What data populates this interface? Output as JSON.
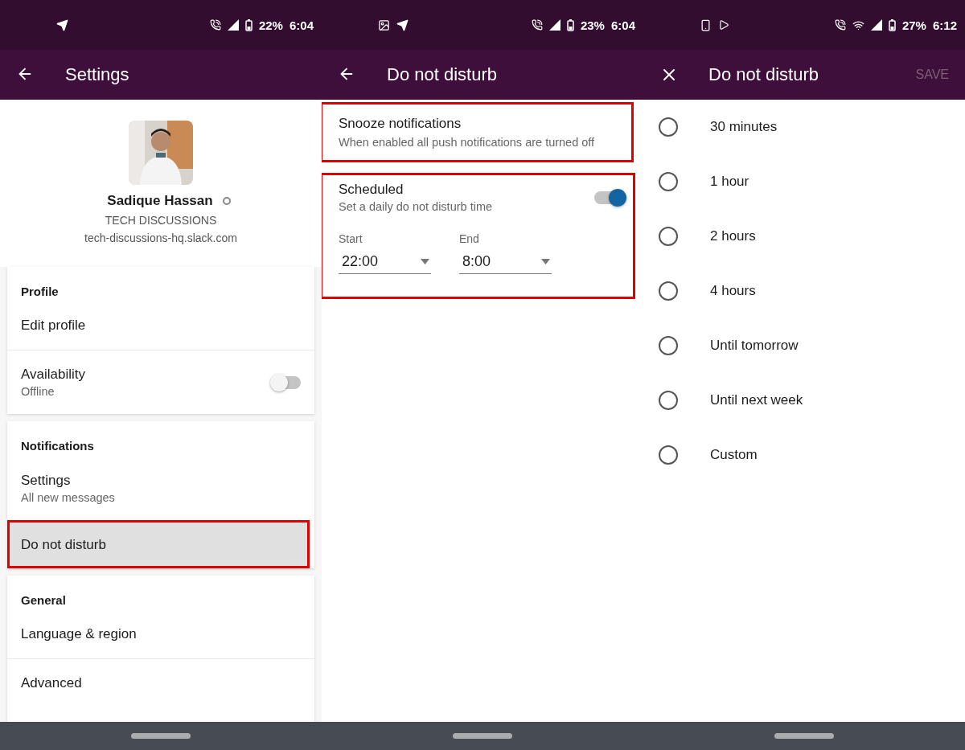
{
  "screens": [
    {
      "kind": "settings",
      "status_bar": {
        "battery": "22%",
        "time": "6:04"
      },
      "app_bar": {
        "nav": {
          "kind": "back"
        },
        "title": "Settings"
      },
      "profile": {
        "name": "Sadique Hassan",
        "online": false,
        "workspace": "TECH DISCUSSIONS",
        "domain": "tech-discussions-hq.slack.com"
      },
      "sections": [
        {
          "header": "Profile",
          "items": [
            {
              "kind": "link",
              "label": "Edit profile"
            },
            {
              "kind": "toggle",
              "label": "Availability",
              "detail": "Offline",
              "on": false
            }
          ]
        },
        {
          "header": "Notifications",
          "items": [
            {
              "kind": "link",
              "label": "Settings",
              "detail": "All new messages"
            },
            {
              "kind": "link",
              "label": "Do not disturb",
              "highlighted": true
            }
          ]
        },
        {
          "header": "General",
          "items": [
            {
              "kind": "link",
              "label": "Language & region"
            },
            {
              "kind": "link",
              "label": "Advanced"
            }
          ]
        }
      ]
    },
    {
      "kind": "dnd",
      "status_bar": {
        "battery": "23%",
        "time": "6:04"
      },
      "app_bar": {
        "nav": {
          "kind": "back"
        },
        "title": "Do not disturb"
      },
      "snooze": {
        "title": "Snooze notifications",
        "detail": "When enabled all push notifications are turned off",
        "highlighted": true
      },
      "schedule": {
        "title": "Scheduled",
        "detail": "Set a daily do not disturb time",
        "on": true,
        "highlighted": true,
        "fields": [
          {
            "label": "Start",
            "value": "22:00"
          },
          {
            "label": "End",
            "value": "8:00"
          }
        ]
      }
    },
    {
      "kind": "duration",
      "status_bar": {
        "battery": "27%",
        "time": "6:12"
      },
      "app_bar": {
        "nav": {
          "kind": "close"
        },
        "title": "Do not disturb",
        "action": {
          "label": "SAVE",
          "disabled": true
        }
      },
      "options": [
        {
          "label": "30 minutes",
          "selected": false
        },
        {
          "label": "1 hour",
          "selected": false
        },
        {
          "label": "2 hours",
          "selected": false
        },
        {
          "label": "4 hours",
          "selected": false
        },
        {
          "label": "Until tomorrow",
          "selected": false
        },
        {
          "label": "Until next week",
          "selected": false
        },
        {
          "label": "Custom",
          "selected": false
        }
      ]
    }
  ]
}
